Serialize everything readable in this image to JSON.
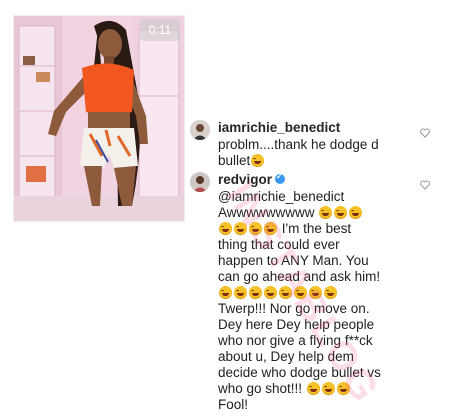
{
  "video": {
    "timer": "0:11"
  },
  "comments": [
    {
      "username": "iamrichie_benedict",
      "text_parts": [
        "problm....thank he dodge d",
        "bullet"
      ],
      "verified": false
    },
    {
      "username": "redvigor",
      "verified": true,
      "lines": [
        "@iamrichie_benedict",
        "Awwwwwwwww",
        "I'm the best",
        "thing that could ever",
        "happen to ANY Man. You",
        "can go ahead and ask him!",
        "Twerp!!! Nor go move on.",
        "Dey here Dey help people",
        "who nor give a flying f**ck",
        "about u, Dey help dem",
        "decide who dodge bullet vs",
        "who go shot!!!",
        "Fool!"
      ]
    }
  ],
  "watermark": "INSTABLOG",
  "icons": {
    "heart": "heart-outline-icon",
    "verified": "verified-badge-icon",
    "emoji": "face-with-tears-of-joy-emoji"
  },
  "colors": {
    "verified_blue": "#3897f0",
    "text": "#262626",
    "watermark": "#f04682"
  }
}
